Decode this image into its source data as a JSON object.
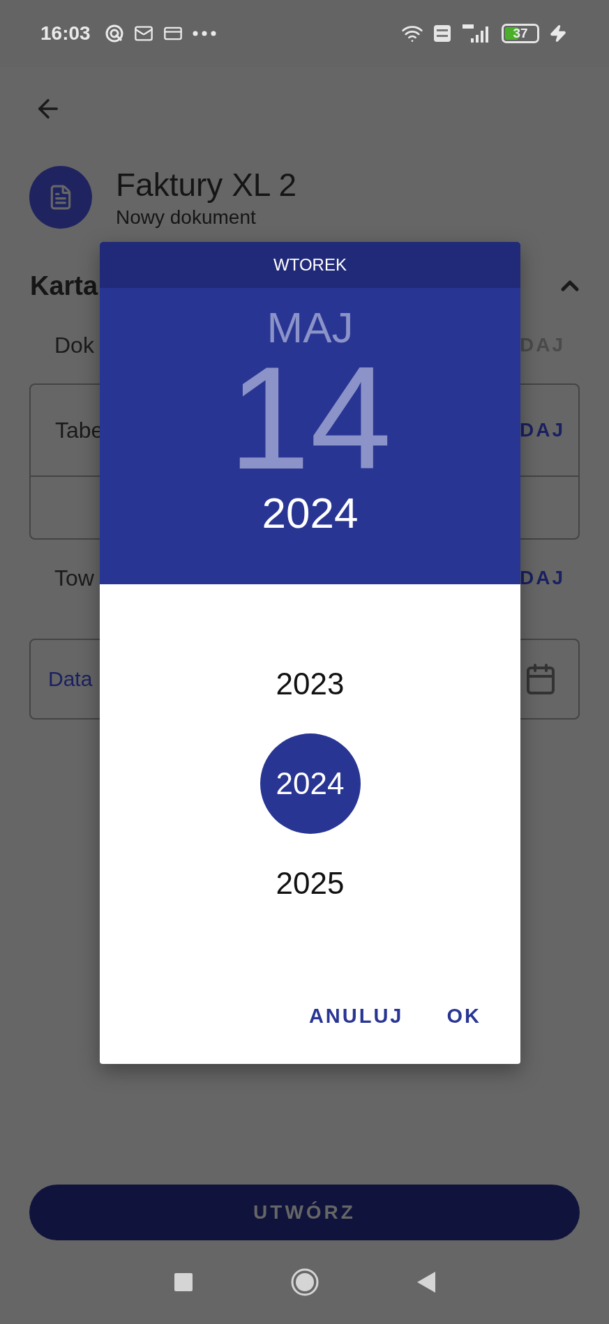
{
  "status_bar": {
    "time": "16:03",
    "battery": "37"
  },
  "header": {
    "title": "Faktury XL 2",
    "subtitle": "Nowy dokument"
  },
  "section": {
    "title": "Karta",
    "expanded": true
  },
  "rows": [
    {
      "kind": "plain",
      "label": "Dok",
      "action": "DAJ",
      "disabled": true
    },
    {
      "kind": "boxed",
      "label": "Tabe",
      "action": "DAJ",
      "disabled": false
    },
    {
      "kind": "plain",
      "label": "Tow",
      "action": "DAJ",
      "disabled": false
    }
  ],
  "date_field": {
    "label": "Data"
  },
  "create_button": {
    "label": "UTWÓRZ",
    "disabled": true
  },
  "dialog": {
    "weekday": "WTOREK",
    "month": "MAJ",
    "day": "14",
    "year": "2024",
    "years": [
      {
        "label": "2023",
        "selected": false
      },
      {
        "label": "2024",
        "selected": true
      },
      {
        "label": "2025",
        "selected": false
      }
    ],
    "buttons": [
      "ANULUJ",
      "OK"
    ]
  }
}
